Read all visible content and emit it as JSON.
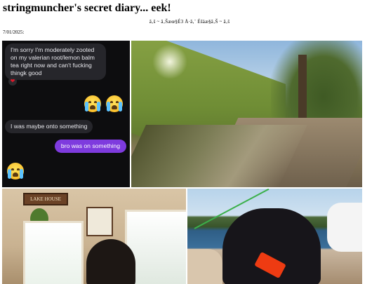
{
  "page": {
    "title": "stringmuncher's secret diary... eek!",
    "subtitle": "ã‚š ~ ã‚Šæœ§É3 Å·ã‚¨ Éšäæ§ã‚Š ~ ã‚š",
    "date": "7/01/2025:"
  },
  "chat": {
    "message_1": "I'm sorry I'm moderately zooted on my valerian root/lemon balm tea right now and can't fucking thingk good",
    "reaction": "❤",
    "message_2": "I was maybe onto something",
    "message_3": "bro was on something",
    "emoji_name": "loudly-crying-face",
    "colors": {
      "background": "#0d0d0f",
      "incoming_bubble": "#26262b",
      "outgoing_bubble": "#7e3bde"
    }
  },
  "photos": {
    "room_sign": "LAKE HOUSE"
  }
}
